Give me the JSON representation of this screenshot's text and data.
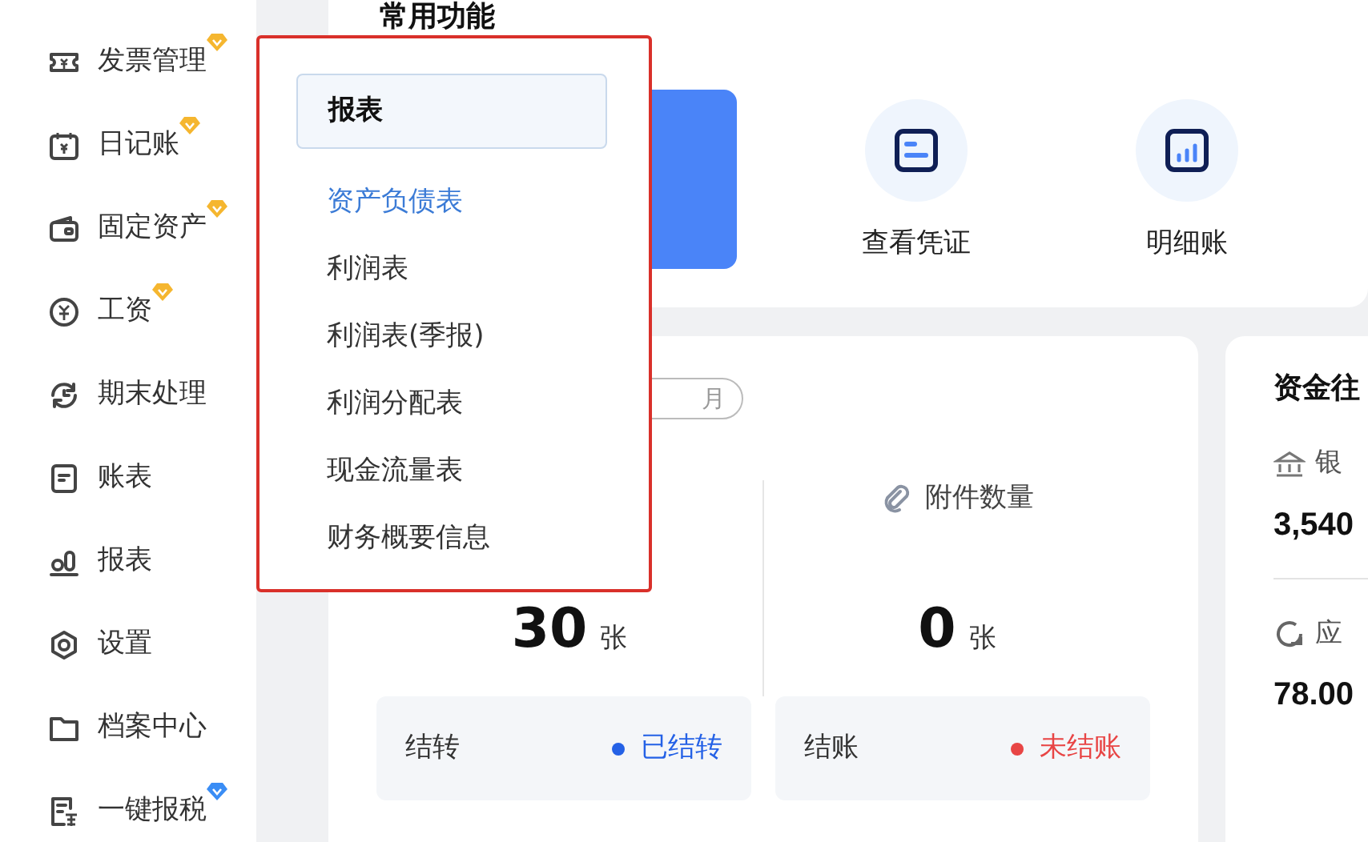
{
  "sidebar": {
    "items": [
      {
        "label": "发票管理",
        "badge": {
          "color": "#f5b62f"
        }
      },
      {
        "label": "日记账",
        "badge": {
          "color": "#f5b62f"
        }
      },
      {
        "label": "固定资产",
        "badge": {
          "color": "#f5b62f"
        }
      },
      {
        "label": "工资",
        "badge": {
          "color": "#f5b62f"
        }
      },
      {
        "label": "期末处理"
      },
      {
        "label": "账表"
      },
      {
        "label": "报表"
      },
      {
        "label": "设置"
      },
      {
        "label": "档案中心"
      },
      {
        "label": "一键报税",
        "badge": {
          "color": "#3a8df5"
        }
      }
    ]
  },
  "shortcuts": {
    "title": "常用功能",
    "items": [
      {
        "label": "查看凭证"
      },
      {
        "label": "明细账"
      }
    ]
  },
  "summary": {
    "period": "月",
    "stats": [
      {
        "value": "30",
        "unit": "张"
      },
      {
        "label": "附件数量",
        "value": "0",
        "unit": "张"
      }
    ],
    "statuses": [
      {
        "label": "结转",
        "status": "已结转",
        "color": "#2461e6"
      },
      {
        "label": "结账",
        "status": "未结账",
        "color": "#e84545"
      }
    ]
  },
  "funds": {
    "title": "资金往",
    "items": [
      {
        "label": "银",
        "value": "3,540"
      },
      {
        "label": "应",
        "value": "78.00"
      }
    ]
  },
  "popup": {
    "title": "报表",
    "items": [
      {
        "label": "资产负债表",
        "selected": true
      },
      {
        "label": "利润表",
        "selected": false
      },
      {
        "label": "利润表(季报)",
        "selected": false
      },
      {
        "label": "利润分配表",
        "selected": false
      },
      {
        "label": "现金流量表",
        "selected": false
      },
      {
        "label": "财务概要信息",
        "selected": false
      }
    ]
  }
}
